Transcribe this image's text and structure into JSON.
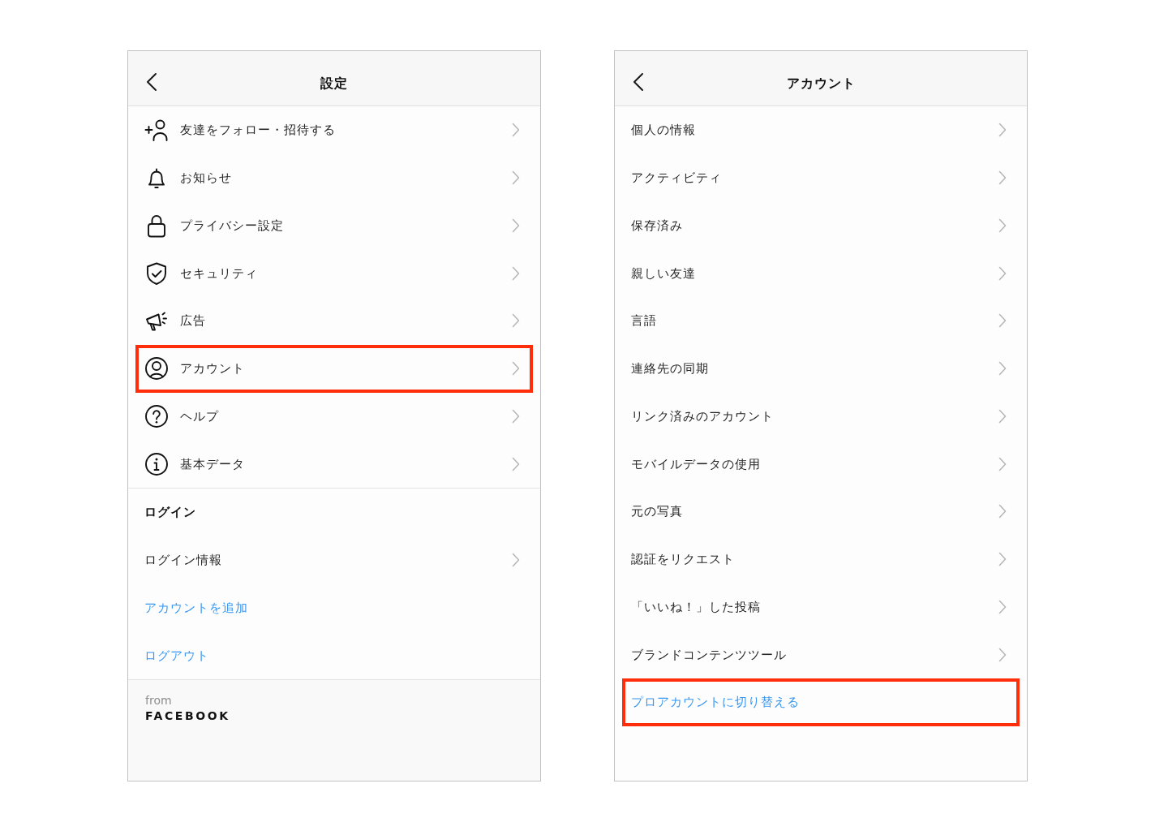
{
  "screens": [
    {
      "title": "設定",
      "items": [
        {
          "kind": "icon_nav",
          "label": "友達をフォロー・招待する",
          "highlighted": false
        },
        {
          "kind": "icon_nav",
          "label": "お知らせ",
          "highlighted": false
        },
        {
          "kind": "icon_nav",
          "label": "プライバシー設定",
          "highlighted": false
        },
        {
          "kind": "icon_nav",
          "label": "セキュリティ",
          "highlighted": false
        },
        {
          "kind": "icon_nav",
          "label": "広告",
          "highlighted": false
        },
        {
          "kind": "icon_nav",
          "label": "アカウント",
          "highlighted": true
        },
        {
          "kind": "icon_nav",
          "label": "ヘルプ",
          "highlighted": false
        },
        {
          "kind": "icon_nav",
          "label": "基本データ",
          "highlighted": false
        }
      ],
      "sections": [
        {
          "heading": "ログイン",
          "items": [
            {
              "kind": "nav",
              "label": "ログイン情報",
              "highlighted": false
            },
            {
              "kind": "link",
              "label": "アカウントを追加",
              "highlighted": false
            },
            {
              "kind": "link",
              "label": "ログアウト",
              "highlighted": false
            }
          ]
        }
      ],
      "footer": {
        "from": "from",
        "brand": "FACEBOOK"
      }
    },
    {
      "title": "アカウント",
      "items": [
        {
          "kind": "nav",
          "label": "個人の情報",
          "highlighted": false
        },
        {
          "kind": "nav",
          "label": "アクティビティ",
          "highlighted": false
        },
        {
          "kind": "nav",
          "label": "保存済み",
          "highlighted": false
        },
        {
          "kind": "nav",
          "label": "親しい友達",
          "highlighted": false
        },
        {
          "kind": "nav",
          "label": "言語",
          "highlighted": false
        },
        {
          "kind": "nav",
          "label": "連絡先の同期",
          "highlighted": false
        },
        {
          "kind": "nav",
          "label": "リンク済みのアカウント",
          "highlighted": false
        },
        {
          "kind": "nav",
          "label": "モバイルデータの使用",
          "highlighted": false
        },
        {
          "kind": "nav",
          "label": "元の写真",
          "highlighted": false
        },
        {
          "kind": "nav",
          "label": "認証をリクエスト",
          "highlighted": false
        },
        {
          "kind": "nav",
          "label": "「いいね！」した投稿",
          "highlighted": false
        },
        {
          "kind": "nav",
          "label": "ブランドコンテンツツール",
          "highlighted": false
        },
        {
          "kind": "link",
          "label": "プロアカウントに切り替える",
          "highlighted": true
        }
      ]
    }
  ]
}
